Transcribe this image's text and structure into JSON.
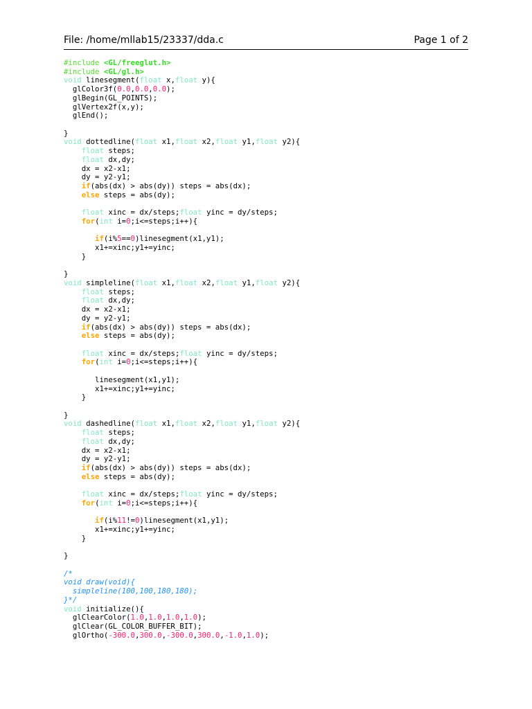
{
  "header": {
    "file": "File: /home/mllab15/23337/dda.c",
    "page": "Page 1 of 2"
  },
  "colors": {
    "type_keyword": "#7fe8c0",
    "control": "#ffa500",
    "number": "#ff1a66",
    "include": "#33dd22",
    "comment": "#1e90ff"
  },
  "code_lines": [
    [
      [
        "h",
        "#include "
      ],
      [
        "s",
        "<GL/freeglut.h>"
      ]
    ],
    [
      [
        "h",
        "#include "
      ],
      [
        "s",
        "<GL/gl.h>"
      ]
    ],
    [
      [
        "k",
        "void"
      ],
      [
        "p",
        " linesegment("
      ],
      [
        "k",
        "float"
      ],
      [
        "p",
        " x,"
      ],
      [
        "k",
        "float"
      ],
      [
        "p",
        " y){"
      ]
    ],
    [
      [
        "p",
        "  glColor3f("
      ],
      [
        "n",
        "0.0"
      ],
      [
        "p",
        ","
      ],
      [
        "n",
        "0.0"
      ],
      [
        "p",
        ","
      ],
      [
        "n",
        "0.0"
      ],
      [
        "p",
        ");"
      ]
    ],
    [
      [
        "p",
        "  glBegin(GL_POINTS);"
      ]
    ],
    [
      [
        "p",
        "  glVertex2f(x,y);"
      ]
    ],
    [
      [
        "p",
        "  glEnd();"
      ]
    ],
    [],
    [
      [
        "p",
        "}"
      ]
    ],
    [
      [
        "k",
        "void"
      ],
      [
        "p",
        " dottedline("
      ],
      [
        "k",
        "float"
      ],
      [
        "p",
        " x1,"
      ],
      [
        "k",
        "float"
      ],
      [
        "p",
        " x2,"
      ],
      [
        "k",
        "float"
      ],
      [
        "p",
        " y1,"
      ],
      [
        "k",
        "float"
      ],
      [
        "p",
        " y2){"
      ]
    ],
    [
      [
        "p",
        "    "
      ],
      [
        "k",
        "float"
      ],
      [
        "p",
        " steps;"
      ]
    ],
    [
      [
        "p",
        "    "
      ],
      [
        "k",
        "float"
      ],
      [
        "p",
        " dx,dy;"
      ]
    ],
    [
      [
        "p",
        "    dx = x2-x1;"
      ]
    ],
    [
      [
        "p",
        "    dy = y2-y1;"
      ]
    ],
    [
      [
        "p",
        "    "
      ],
      [
        "c",
        "if"
      ],
      [
        "p",
        "(abs(dx) > abs(dy)) steps = abs(dx);"
      ]
    ],
    [
      [
        "p",
        "    "
      ],
      [
        "c",
        "else"
      ],
      [
        "p",
        " steps = abs(dy);"
      ]
    ],
    [],
    [
      [
        "p",
        "    "
      ],
      [
        "k",
        "float"
      ],
      [
        "p",
        " xinc = dx/steps;"
      ],
      [
        "k",
        "float"
      ],
      [
        "p",
        " yinc = dy/steps;"
      ]
    ],
    [
      [
        "p",
        "    "
      ],
      [
        "c",
        "for"
      ],
      [
        "p",
        "("
      ],
      [
        "k",
        "int"
      ],
      [
        "p",
        " i="
      ],
      [
        "n",
        "0"
      ],
      [
        "p",
        ";i<=steps;i++){"
      ]
    ],
    [],
    [
      [
        "p",
        "       "
      ],
      [
        "c",
        "if"
      ],
      [
        "p",
        "(i%"
      ],
      [
        "n",
        "5"
      ],
      [
        "p",
        "=="
      ],
      [
        "n",
        "0"
      ],
      [
        "p",
        ")linesegment(x1,y1);"
      ]
    ],
    [
      [
        "p",
        "       x1+=xinc;y1+=yinc;"
      ]
    ],
    [
      [
        "p",
        "    }"
      ]
    ],
    [],
    [
      [
        "p",
        "}"
      ]
    ],
    [
      [
        "k",
        "void"
      ],
      [
        "p",
        " simpleline("
      ],
      [
        "k",
        "float"
      ],
      [
        "p",
        " x1,"
      ],
      [
        "k",
        "float"
      ],
      [
        "p",
        " x2,"
      ],
      [
        "k",
        "float"
      ],
      [
        "p",
        " y1,"
      ],
      [
        "k",
        "float"
      ],
      [
        "p",
        " y2){"
      ]
    ],
    [
      [
        "p",
        "    "
      ],
      [
        "k",
        "float"
      ],
      [
        "p",
        " steps;"
      ]
    ],
    [
      [
        "p",
        "    "
      ],
      [
        "k",
        "float"
      ],
      [
        "p",
        " dx,dy;"
      ]
    ],
    [
      [
        "p",
        "    dx = x2-x1;"
      ]
    ],
    [
      [
        "p",
        "    dy = y2-y1;"
      ]
    ],
    [
      [
        "p",
        "    "
      ],
      [
        "c",
        "if"
      ],
      [
        "p",
        "(abs(dx) > abs(dy)) steps = abs(dx);"
      ]
    ],
    [
      [
        "p",
        "    "
      ],
      [
        "c",
        "else"
      ],
      [
        "p",
        " steps = abs(dy);"
      ]
    ],
    [],
    [
      [
        "p",
        "    "
      ],
      [
        "k",
        "float"
      ],
      [
        "p",
        " xinc = dx/steps;"
      ],
      [
        "k",
        "float"
      ],
      [
        "p",
        " yinc = dy/steps;"
      ]
    ],
    [
      [
        "p",
        "    "
      ],
      [
        "c",
        "for"
      ],
      [
        "p",
        "("
      ],
      [
        "k",
        "int"
      ],
      [
        "p",
        " i="
      ],
      [
        "n",
        "0"
      ],
      [
        "p",
        ";i<=steps;i++){"
      ]
    ],
    [],
    [
      [
        "p",
        "       linesegment(x1,y1);"
      ]
    ],
    [
      [
        "p",
        "       x1+=xinc;y1+=yinc;"
      ]
    ],
    [
      [
        "p",
        "    }"
      ]
    ],
    [],
    [
      [
        "p",
        "}"
      ]
    ],
    [
      [
        "k",
        "void"
      ],
      [
        "p",
        " dashedline("
      ],
      [
        "k",
        "float"
      ],
      [
        "p",
        " x1,"
      ],
      [
        "k",
        "float"
      ],
      [
        "p",
        " x2,"
      ],
      [
        "k",
        "float"
      ],
      [
        "p",
        " y1,"
      ],
      [
        "k",
        "float"
      ],
      [
        "p",
        " y2){"
      ]
    ],
    [
      [
        "p",
        "    "
      ],
      [
        "k",
        "float"
      ],
      [
        "p",
        " steps;"
      ]
    ],
    [
      [
        "p",
        "    "
      ],
      [
        "k",
        "float"
      ],
      [
        "p",
        " dx,dy;"
      ]
    ],
    [
      [
        "p",
        "    dx = x2-x1;"
      ]
    ],
    [
      [
        "p",
        "    dy = y2-y1;"
      ]
    ],
    [
      [
        "p",
        "    "
      ],
      [
        "c",
        "if"
      ],
      [
        "p",
        "(abs(dx) > abs(dy)) steps = abs(dx);"
      ]
    ],
    [
      [
        "p",
        "    "
      ],
      [
        "c",
        "else"
      ],
      [
        "p",
        " steps = abs(dy);"
      ]
    ],
    [],
    [
      [
        "p",
        "    "
      ],
      [
        "k",
        "float"
      ],
      [
        "p",
        " xinc = dx/steps;"
      ],
      [
        "k",
        "float"
      ],
      [
        "p",
        " yinc = dy/steps;"
      ]
    ],
    [
      [
        "p",
        "    "
      ],
      [
        "c",
        "for"
      ],
      [
        "p",
        "("
      ],
      [
        "k",
        "int"
      ],
      [
        "p",
        " i="
      ],
      [
        "n",
        "0"
      ],
      [
        "p",
        ";i<=steps;i++){"
      ]
    ],
    [],
    [
      [
        "p",
        "       "
      ],
      [
        "c",
        "if"
      ],
      [
        "p",
        "(i%"
      ],
      [
        "n",
        "11"
      ],
      [
        "p",
        "!="
      ],
      [
        "n",
        "0"
      ],
      [
        "p",
        ")linesegment(x1,y1);"
      ]
    ],
    [
      [
        "p",
        "       x1+=xinc;y1+=yinc;"
      ]
    ],
    [
      [
        "p",
        "    }"
      ]
    ],
    [],
    [
      [
        "p",
        "}"
      ]
    ],
    [],
    [
      [
        "m",
        "/*"
      ]
    ],
    [
      [
        "m",
        "void draw(void){"
      ]
    ],
    [
      [
        "m",
        "  simpleline(100,100,180,180);"
      ]
    ],
    [
      [
        "m",
        "}*/"
      ]
    ],
    [
      [
        "k",
        "void"
      ],
      [
        "p",
        " initialize(){"
      ]
    ],
    [
      [
        "p",
        "  glClearColor("
      ],
      [
        "n",
        "1.0"
      ],
      [
        "p",
        ","
      ],
      [
        "n",
        "1.0"
      ],
      [
        "p",
        ","
      ],
      [
        "n",
        "1.0"
      ],
      [
        "p",
        ","
      ],
      [
        "n",
        "1.0"
      ],
      [
        "p",
        ");"
      ]
    ],
    [
      [
        "p",
        "  glClear(GL_COLOR_BUFFER_BIT);"
      ]
    ],
    [
      [
        "p",
        "  glOrtho("
      ],
      [
        "n",
        "-300.0"
      ],
      [
        "p",
        ","
      ],
      [
        "n",
        "300.0"
      ],
      [
        "p",
        ","
      ],
      [
        "n",
        "-300.0"
      ],
      [
        "p",
        ","
      ],
      [
        "n",
        "300.0"
      ],
      [
        "p",
        ","
      ],
      [
        "n",
        "-1.0"
      ],
      [
        "p",
        ","
      ],
      [
        "n",
        "1.0"
      ],
      [
        "p",
        ");"
      ]
    ]
  ]
}
